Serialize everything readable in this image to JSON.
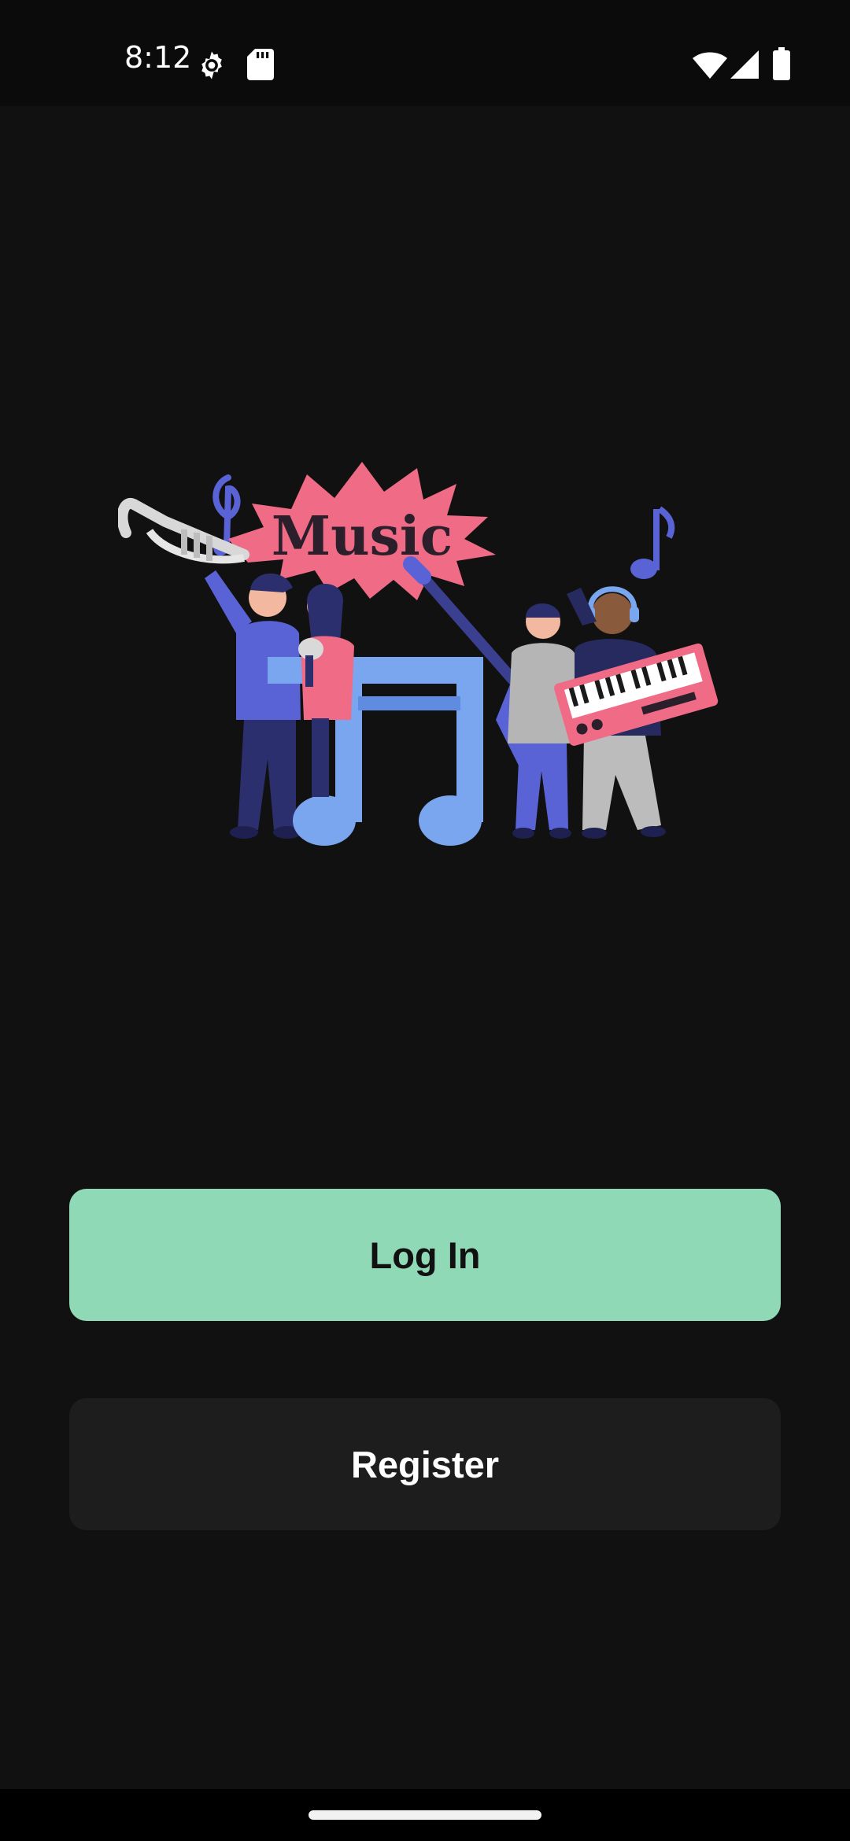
{
  "status_bar": {
    "time": "8:12",
    "icons": [
      "gear-icon",
      "sd-card-icon",
      "wifi-icon",
      "cell-signal-icon",
      "battery-icon"
    ]
  },
  "hero": {
    "logo_text": "Music",
    "colors": {
      "badge": "#ef6b86",
      "note": "#7aa6ef",
      "figure_blue": "#5a63d6",
      "figure_navy": "#2b2f6e",
      "keyboard": "#ef6b86"
    }
  },
  "buttons": {
    "login_label": "Log In",
    "register_label": "Register"
  },
  "theme": {
    "background": "#111111",
    "login_bg": "#8fd9b7",
    "register_bg": "#1d1d1d"
  }
}
